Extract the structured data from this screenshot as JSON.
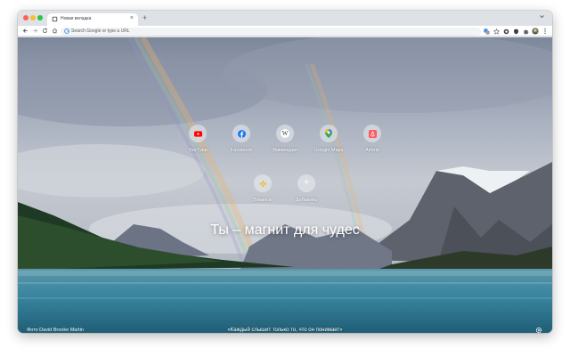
{
  "tab": {
    "title": "Новая вкладка",
    "close": "×",
    "new_tab": "+"
  },
  "toolbar": {
    "omnibox_placeholder": "Search Google or type a URL"
  },
  "shortcuts": [
    {
      "label": "YouTube",
      "icon": "youtube-icon",
      "color": "#ff0000"
    },
    {
      "label": "Facebook",
      "icon": "facebook-icon",
      "color": "#1877f2"
    },
    {
      "label": "Википедия",
      "icon": "wikipedia-icon",
      "glyph": "W",
      "color": "#333333"
    },
    {
      "label": "Google Maps",
      "icon": "google-maps-icon",
      "color": "#34a853"
    },
    {
      "label": "Airbnb",
      "icon": "airbnb-icon",
      "color": "#ff5a5f"
    },
    {
      "label": "Binance",
      "icon": "binance-icon",
      "color": "#f0b90b"
    },
    {
      "label": "Добавить",
      "icon": "add-shortcut-icon",
      "glyph": "+",
      "color": "#ffffff"
    }
  ],
  "headline": "Ты – магнит для чудес",
  "photo_credit": "Фото David Brooke Martin",
  "quote": "«Каждый слышит только то, что он понимает»",
  "colors": {
    "accent": "#1a73e8",
    "tabstrip": "#dee1e6"
  }
}
